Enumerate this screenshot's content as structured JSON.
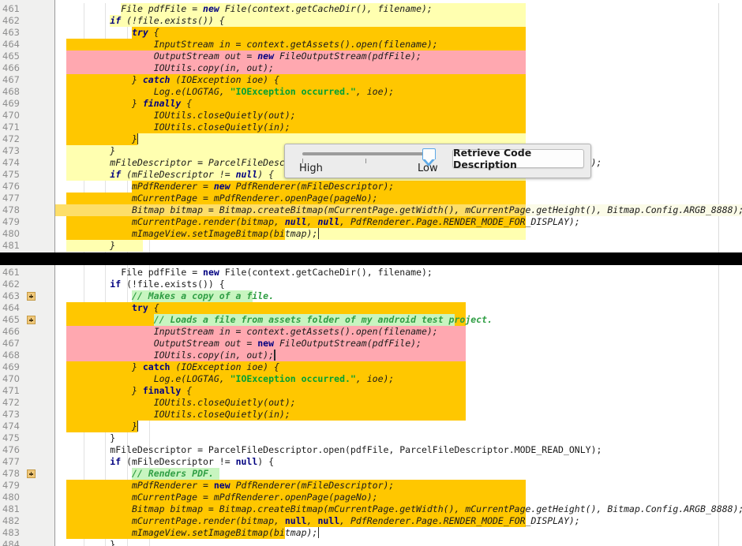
{
  "colors": {
    "highlight_strong": "#FFC700",
    "highlight_pale": "#FFFFB0",
    "highlight_pink": "#FFA8B0",
    "comment_highlight": "#C8F5C0",
    "gutter_bg": "#F0F0EF",
    "divider": "#000000",
    "slider_accent": "#5EA9E6",
    "keyword": "#000080",
    "string": "#00A033",
    "comment": "#2F9E44"
  },
  "slider_popup": {
    "name": "code-description-slider",
    "label_high": "High",
    "label_low": "Low",
    "button_label": "Retrieve Code Description",
    "thumb_position": "Low",
    "tick_count": 3
  },
  "panels": [
    {
      "id": "top",
      "name": "code-panel-before",
      "first_line": 461,
      "last_line": 481,
      "lines": [
        {
          "n": 461,
          "indent": 12,
          "fold": false,
          "caret": false,
          "hl": "pale",
          "hl_from": 12,
          "hl_to": 86,
          "tokens": [
            {
              "t": "File pdfFile = ",
              "c": "it"
            },
            {
              "t": "new",
              "c": "kw"
            },
            {
              "t": " File(context.getCacheDir(), filename);",
              "c": "it"
            }
          ]
        },
        {
          "n": 462,
          "indent": 10,
          "fold": false,
          "caret": false,
          "hl": "pale",
          "hl_from": 10,
          "hl_to": 86,
          "tokens": [
            {
              "t": "if",
              "c": "kw"
            },
            {
              "t": " (!file.exists()) {",
              "c": "it"
            }
          ]
        },
        {
          "n": 463,
          "indent": 14,
          "fold": false,
          "caret": false,
          "hl": "strong",
          "hl_from": 14,
          "hl_to": 86,
          "tokens": [
            {
              "t": "try",
              "c": "kw"
            },
            {
              "t": " {",
              "c": "it"
            }
          ]
        },
        {
          "n": 464,
          "indent": 18,
          "fold": false,
          "caret": false,
          "hl": "strong",
          "hl_from": 2,
          "hl_to": 86,
          "tokens": [
            {
              "t": "InputStream in = context.getAssets().open(filename);",
              "c": "it"
            }
          ]
        },
        {
          "n": 465,
          "indent": 18,
          "fold": false,
          "caret": false,
          "hl": "pink",
          "hl_from": 2,
          "hl_to": 86,
          "tokens": [
            {
              "t": "OutputStream out = ",
              "c": "it"
            },
            {
              "t": "new",
              "c": "kw"
            },
            {
              "t": " FileOutputStream(pdfFile);",
              "c": "it"
            }
          ]
        },
        {
          "n": 466,
          "indent": 18,
          "fold": false,
          "caret": false,
          "hl": "pink",
          "hl_from": 2,
          "hl_to": 86,
          "tokens": [
            {
              "t": "IOUtils.copy(in, out);",
              "c": "it"
            }
          ]
        },
        {
          "n": 467,
          "indent": 14,
          "fold": false,
          "caret": false,
          "hl": "strong",
          "hl_from": 2,
          "hl_to": 86,
          "tokens": [
            {
              "t": "} ",
              "c": "it"
            },
            {
              "t": "catch",
              "c": "kw"
            },
            {
              "t": " (IOException ioe) {",
              "c": "it"
            }
          ]
        },
        {
          "n": 468,
          "indent": 18,
          "fold": false,
          "caret": false,
          "hl": "strong",
          "hl_from": 2,
          "hl_to": 86,
          "tokens": [
            {
              "t": "Log.e(LOGTAG, ",
              "c": "it"
            },
            {
              "t": "\"IOException occurred.\"",
              "c": "str"
            },
            {
              "t": ", ioe);",
              "c": "it"
            }
          ]
        },
        {
          "n": 469,
          "indent": 14,
          "fold": false,
          "caret": false,
          "hl": "strong",
          "hl_from": 2,
          "hl_to": 86,
          "tokens": [
            {
              "t": "} ",
              "c": "it"
            },
            {
              "t": "finally",
              "c": "kw"
            },
            {
              "t": " {",
              "c": "it"
            }
          ]
        },
        {
          "n": 470,
          "indent": 18,
          "fold": false,
          "caret": false,
          "hl": "strong",
          "hl_from": 2,
          "hl_to": 86,
          "tokens": [
            {
              "t": "IOUtils.closeQuietly(out);",
              "c": "it"
            }
          ]
        },
        {
          "n": 471,
          "indent": 18,
          "fold": false,
          "caret": false,
          "hl": "strong",
          "hl_from": 2,
          "hl_to": 86,
          "tokens": [
            {
              "t": "IOUtils.closeQuietly(in);",
              "c": "it"
            }
          ]
        },
        {
          "n": 472,
          "indent": 14,
          "fold": false,
          "caret": true,
          "hl": "strong",
          "hl_from": 2,
          "hl_to": 15,
          "hl2": "pale",
          "hl2_from": 15,
          "hl2_to": 86,
          "tokens": [
            {
              "t": "}",
              "c": "it"
            }
          ]
        },
        {
          "n": 473,
          "indent": 10,
          "fold": false,
          "caret": false,
          "hl": "pale",
          "hl_from": 2,
          "hl_to": 86,
          "tokens": [
            {
              "t": "}",
              "c": "it"
            }
          ]
        },
        {
          "n": 474,
          "indent": 10,
          "fold": false,
          "caret": false,
          "hl": "pale",
          "hl_from": 2,
          "hl_to": 86,
          "tokens": [
            {
              "t": "mFileDescriptor = ParcelFileDescriptor.open(pdfFile, ParcelFileDescriptor.MODE_READ_ONLY);",
              "c": "it"
            }
          ]
        },
        {
          "n": 475,
          "indent": 10,
          "fold": false,
          "caret": false,
          "hl": "pale",
          "hl_from": 2,
          "hl_to": 86,
          "tokens": [
            {
              "t": "if",
              "c": "kw"
            },
            {
              "t": " (mFileDescriptor != ",
              "c": "it"
            },
            {
              "t": "null",
              "c": "kw"
            },
            {
              "t": ") {",
              "c": "it"
            }
          ]
        },
        {
          "n": 476,
          "indent": 14,
          "fold": false,
          "caret": false,
          "hl": "strong",
          "hl_from": 14,
          "hl_to": 86,
          "tokens": [
            {
              "t": "mPdfRenderer = ",
              "c": "it"
            },
            {
              "t": "new",
              "c": "kw"
            },
            {
              "t": " PdfRenderer(mFileDescriptor);",
              "c": "it"
            }
          ]
        },
        {
          "n": 477,
          "indent": 14,
          "fold": false,
          "caret": false,
          "hl": "strong",
          "hl_from": 2,
          "hl_to": 86,
          "tokens": [
            {
              "t": "mCurrentPage = mPdfRenderer.openPage(pageNo);",
              "c": "it"
            }
          ]
        },
        {
          "n": 478,
          "indent": 14,
          "fold": false,
          "caret": false,
          "hl": "caretline",
          "hl_from": 0,
          "hl_to": 86,
          "tokens": [
            {
              "t": "Bitmap bitmap = Bitmap.createBitmap(mCurrentPage.getWidth(), mCurrentPage.getHeight(), Bitmap.Config.ARGB_8888);",
              "c": "it"
            }
          ]
        },
        {
          "n": 479,
          "indent": 14,
          "fold": false,
          "caret": false,
          "hl": "strong",
          "hl_from": 2,
          "hl_to": 86,
          "tokens": [
            {
              "t": "mCurrentPage.render(bitmap, ",
              "c": "it"
            },
            {
              "t": "null",
              "c": "kw"
            },
            {
              "t": ", ",
              "c": "it"
            },
            {
              "t": "null",
              "c": "kw"
            },
            {
              "t": ", PdfRenderer.Page.RENDER_MODE_FOR_DISPLAY);",
              "c": "it"
            }
          ]
        },
        {
          "n": 480,
          "indent": 14,
          "fold": false,
          "caret": true,
          "hl": "strong",
          "hl_from": 2,
          "hl_to": 42,
          "hl2": "pale",
          "hl2_from": 42,
          "hl2_to": 86,
          "tokens": [
            {
              "t": "mImageView.setImageBitmap(bitmap);",
              "c": "it"
            }
          ]
        },
        {
          "n": 481,
          "indent": 10,
          "fold": false,
          "caret": false,
          "hl": "pale",
          "hl_from": 2,
          "hl_to": 16,
          "tokens": [
            {
              "t": "}",
              "c": "it"
            }
          ]
        }
      ]
    },
    {
      "id": "bottom",
      "name": "code-panel-after",
      "first_line": 461,
      "last_line": 484,
      "lines": [
        {
          "n": 461,
          "indent": 12,
          "fold": false,
          "caret": false,
          "hl": "none",
          "tokens": [
            {
              "t": "File pdfFile = ",
              "c": ""
            },
            {
              "t": "new",
              "c": "kw"
            },
            {
              "t": " File(context.getCacheDir(), filename);",
              "c": ""
            }
          ]
        },
        {
          "n": 462,
          "indent": 10,
          "fold": false,
          "caret": false,
          "hl": "none",
          "tokens": [
            {
              "t": "if",
              "c": "kw"
            },
            {
              "t": " (!file.exists()) {",
              "c": ""
            }
          ]
        },
        {
          "n": 463,
          "indent": 14,
          "fold": true,
          "caret": false,
          "hl": "comment",
          "hl_from": 14,
          "hl_to": 36,
          "tokens": [
            {
              "t": "// Makes a copy of a file.",
              "c": "cmt"
            }
          ]
        },
        {
          "n": 464,
          "indent": 14,
          "fold": false,
          "caret": false,
          "hl": "strong",
          "hl_from": 2,
          "hl_to": 75,
          "tokens": [
            {
              "t": "try",
              "c": "kw"
            },
            {
              "t": " {",
              "c": "it"
            }
          ]
        },
        {
          "n": 465,
          "indent": 18,
          "fold": true,
          "caret": false,
          "hl": "strong",
          "hl_from": 2,
          "hl_to": 75,
          "hl_comment_from": 18,
          "hl_comment_to": 73,
          "tokens": [
            {
              "t": "// Loads a file from assets folder of my android test project.",
              "c": "cmt"
            }
          ]
        },
        {
          "n": 466,
          "indent": 18,
          "fold": false,
          "caret": false,
          "hl": "pink",
          "hl_from": 2,
          "hl_to": 75,
          "tokens": [
            {
              "t": "InputStream in = context.getAssets().open(filename);",
              "c": "it"
            }
          ]
        },
        {
          "n": 467,
          "indent": 18,
          "fold": false,
          "caret": false,
          "hl": "pink",
          "hl_from": 2,
          "hl_to": 75,
          "tokens": [
            {
              "t": "OutputStream out = ",
              "c": "it"
            },
            {
              "t": "new",
              "c": "kw"
            },
            {
              "t": " FileOutputStream(pdfFile);",
              "c": "it"
            }
          ]
        },
        {
          "n": 468,
          "indent": 18,
          "fold": false,
          "caret": true,
          "hl": "pink",
          "hl_from": 2,
          "hl_to": 75,
          "tokens": [
            {
              "t": "IOUtils.copy(in, out);",
              "c": "it"
            }
          ]
        },
        {
          "n": 469,
          "indent": 14,
          "fold": false,
          "caret": false,
          "hl": "strong",
          "hl_from": 2,
          "hl_to": 75,
          "tokens": [
            {
              "t": "} ",
              "c": "it"
            },
            {
              "t": "catch",
              "c": "kw"
            },
            {
              "t": " (IOException ioe) {",
              "c": "it"
            }
          ]
        },
        {
          "n": 470,
          "indent": 18,
          "fold": false,
          "caret": false,
          "hl": "strong",
          "hl_from": 2,
          "hl_to": 75,
          "tokens": [
            {
              "t": "Log.e(LOGTAG, ",
              "c": "it"
            },
            {
              "t": "\"IOException occurred.\"",
              "c": "str"
            },
            {
              "t": ", ioe);",
              "c": "it"
            }
          ]
        },
        {
          "n": 471,
          "indent": 14,
          "fold": false,
          "caret": false,
          "hl": "strong",
          "hl_from": 2,
          "hl_to": 75,
          "tokens": [
            {
              "t": "} ",
              "c": "it"
            },
            {
              "t": "finally",
              "c": "kw"
            },
            {
              "t": " {",
              "c": "it"
            }
          ]
        },
        {
          "n": 472,
          "indent": 18,
          "fold": false,
          "caret": false,
          "hl": "strong",
          "hl_from": 2,
          "hl_to": 75,
          "tokens": [
            {
              "t": "IOUtils.closeQuietly(out);",
              "c": "it"
            }
          ]
        },
        {
          "n": 473,
          "indent": 18,
          "fold": false,
          "caret": false,
          "hl": "strong",
          "hl_from": 2,
          "hl_to": 75,
          "tokens": [
            {
              "t": "IOUtils.closeQuietly(in);",
              "c": "it"
            }
          ]
        },
        {
          "n": 474,
          "indent": 14,
          "fold": false,
          "caret": true,
          "hl": "strong",
          "hl_from": 2,
          "hl_to": 15,
          "tokens": [
            {
              "t": "}",
              "c": "it"
            }
          ]
        },
        {
          "n": 475,
          "indent": 10,
          "fold": false,
          "caret": false,
          "hl": "none",
          "tokens": [
            {
              "t": "}",
              "c": ""
            }
          ]
        },
        {
          "n": 476,
          "indent": 10,
          "fold": false,
          "caret": false,
          "hl": "none",
          "tokens": [
            {
              "t": "mFileDescriptor = ParcelFileDescriptor.open(pdfFile, ParcelFileDescriptor.MODE_READ_ONLY);",
              "c": ""
            }
          ]
        },
        {
          "n": 477,
          "indent": 10,
          "fold": false,
          "caret": false,
          "hl": "none",
          "tokens": [
            {
              "t": "if",
              "c": "kw"
            },
            {
              "t": " (mFileDescriptor != ",
              "c": ""
            },
            {
              "t": "null",
              "c": "kw"
            },
            {
              "t": ") {",
              "c": ""
            }
          ]
        },
        {
          "n": 478,
          "indent": 14,
          "fold": true,
          "caret": false,
          "hl": "comment",
          "hl_from": 14,
          "hl_to": 30,
          "tokens": [
            {
              "t": "// Renders PDF.",
              "c": "cmt"
            }
          ]
        },
        {
          "n": 479,
          "indent": 14,
          "fold": false,
          "caret": false,
          "hl": "strong",
          "hl_from": 2,
          "hl_to": 86,
          "tokens": [
            {
              "t": "mPdfRenderer = ",
              "c": "it"
            },
            {
              "t": "new",
              "c": "kw"
            },
            {
              "t": " PdfRenderer(mFileDescriptor);",
              "c": "it"
            }
          ]
        },
        {
          "n": 480,
          "indent": 14,
          "fold": false,
          "caret": false,
          "hl": "strong",
          "hl_from": 2,
          "hl_to": 86,
          "tokens": [
            {
              "t": "mCurrentPage = mPdfRenderer.openPage(pageNo);",
              "c": "it"
            }
          ]
        },
        {
          "n": 481,
          "indent": 14,
          "fold": false,
          "caret": false,
          "hl": "strong",
          "hl_from": 2,
          "hl_to": 86,
          "tokens": [
            {
              "t": "Bitmap bitmap = Bitmap.createBitmap(mCurrentPage.getWidth(), mCurrentPage.getHeight(), Bitmap.Config.ARGB_8888);",
              "c": "it"
            }
          ]
        },
        {
          "n": 482,
          "indent": 14,
          "fold": false,
          "caret": false,
          "hl": "strong",
          "hl_from": 2,
          "hl_to": 86,
          "tokens": [
            {
              "t": "mCurrentPage.render(bitmap, ",
              "c": "it"
            },
            {
              "t": "null",
              "c": "kw"
            },
            {
              "t": ", ",
              "c": "it"
            },
            {
              "t": "null",
              "c": "kw"
            },
            {
              "t": ", PdfRenderer.Page.RENDER_MODE_FOR_DISPLAY);",
              "c": "it"
            }
          ]
        },
        {
          "n": 483,
          "indent": 14,
          "fold": false,
          "caret": true,
          "hl": "strong",
          "hl_from": 2,
          "hl_to": 42,
          "tokens": [
            {
              "t": "mImageView.setImageBitmap(bitmap);",
              "c": "it"
            }
          ]
        },
        {
          "n": 484,
          "indent": 10,
          "fold": false,
          "caret": false,
          "hl": "none",
          "tokens": [
            {
              "t": "}",
              "c": ""
            }
          ]
        }
      ]
    }
  ]
}
